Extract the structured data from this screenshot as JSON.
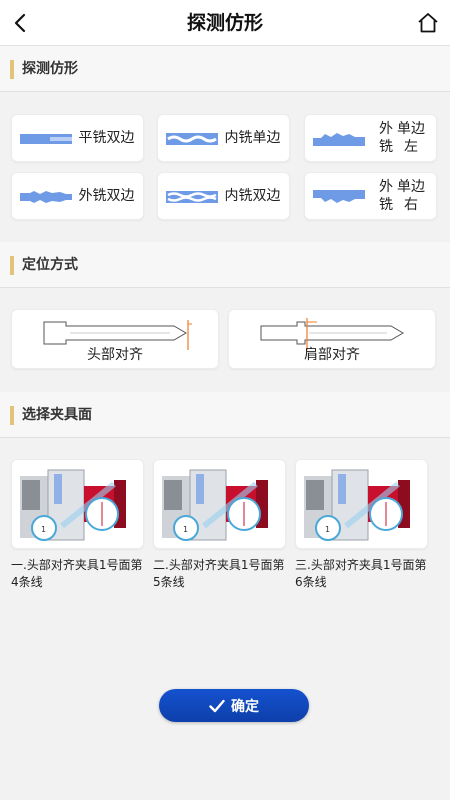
{
  "header": {
    "title": "探测仿形",
    "back_icon": "chevron-left-icon",
    "home_icon": "home-icon"
  },
  "sections": {
    "shape": {
      "title": "探测仿形"
    },
    "position": {
      "title": "定位方式"
    },
    "fixture": {
      "title": "选择夹具面"
    }
  },
  "shape_options": [
    {
      "label": "平铣双边",
      "icon": "flat-double-key-icon"
    },
    {
      "label": "内铣单边",
      "icon": "inner-single-key-icon"
    },
    {
      "label_line1": "外铣",
      "label_line2": "单边左",
      "icon": "outer-single-left-key-icon"
    },
    {
      "label": "外铣双边",
      "icon": "outer-double-key-icon"
    },
    {
      "label": "内铣双边",
      "icon": "inner-double-key-icon"
    },
    {
      "label_line1": "外铣",
      "label_line2": "单边右",
      "icon": "outer-single-right-key-icon"
    }
  ],
  "position_options": [
    {
      "label": "头部对齐"
    },
    {
      "label": "肩部对齐"
    }
  ],
  "fixture_options": [
    {
      "label": "一.头部对齐夹具1号面第4条线"
    },
    {
      "label": "二.头部对齐夹具1号面第5条线"
    },
    {
      "label": "三.头部对齐夹具1号面第6条线"
    }
  ],
  "confirm": {
    "label": "确定",
    "icon": "check-icon"
  },
  "colors": {
    "accent": "#1552cf",
    "section_bar": "#e1c47a",
    "key_blue": "#6f9be6",
    "marker_orange": "#f07c2a",
    "fixture_red": "#c8102e"
  }
}
